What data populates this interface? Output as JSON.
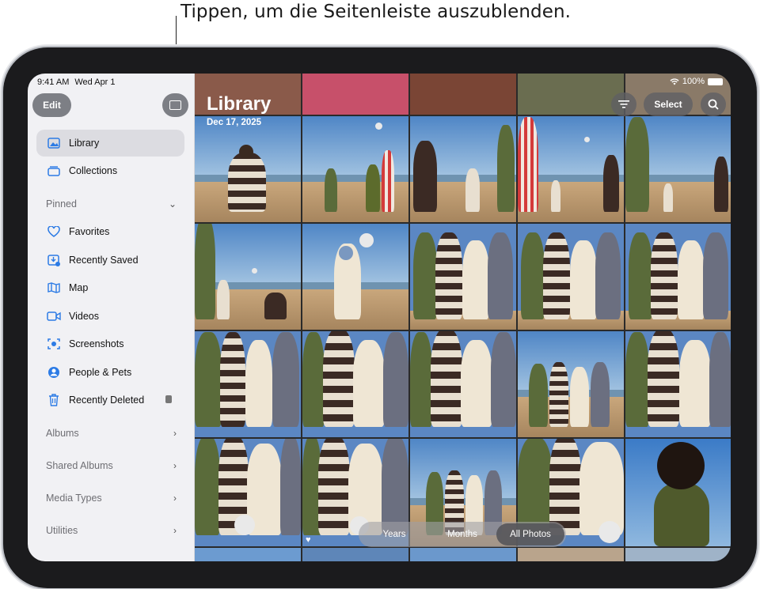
{
  "callout": "Tippen, um die Seitenleiste auszublenden.",
  "status": {
    "time": "9:41 AM",
    "date": "Wed Apr 1",
    "battery": "100%"
  },
  "toolbar": {
    "edit_label": "Edit",
    "select_label": "Select"
  },
  "sidebar": {
    "items": [
      {
        "label": "Library",
        "icon": "photo-library-icon"
      },
      {
        "label": "Collections",
        "icon": "collections-icon"
      }
    ],
    "pinned_label": "Pinned",
    "pinned_items": [
      {
        "label": "Favorites",
        "icon": "heart-icon"
      },
      {
        "label": "Recently Saved",
        "icon": "recently-saved-icon"
      },
      {
        "label": "Map",
        "icon": "map-icon"
      },
      {
        "label": "Videos",
        "icon": "video-icon"
      },
      {
        "label": "Screenshots",
        "icon": "screenshot-icon"
      },
      {
        "label": "People & Pets",
        "icon": "person-icon"
      },
      {
        "label": "Recently Deleted",
        "icon": "trash-icon"
      }
    ],
    "sections": [
      "Albums",
      "Shared Albums",
      "Media Types",
      "Utilities"
    ]
  },
  "main": {
    "title": "Library",
    "date": "Dec 17, 2025",
    "view_options": [
      "Years",
      "Months",
      "All Photos"
    ],
    "selected_view": "All Photos"
  },
  "colors": {
    "accent": "#2c7be5",
    "sidebar_bg": "#f1f1f4",
    "selected_row": "#dcdce1"
  }
}
